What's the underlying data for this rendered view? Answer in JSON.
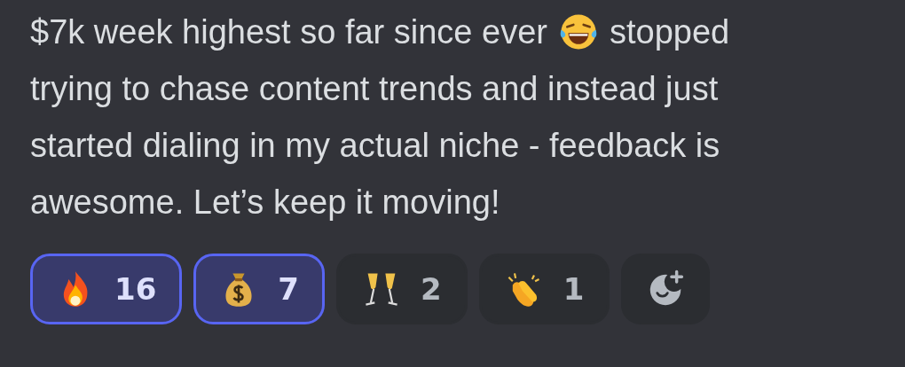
{
  "message": {
    "first_line": {
      "before": "$7k week highest so far since ever",
      "after": "stopped"
    },
    "lines": [
      "trying to chase content trends and instead just",
      "started dialing in my actual niche - feedback is",
      "awesome. Let’s keep it moving!"
    ]
  },
  "reactions": [
    {
      "count": "16",
      "selected": true
    },
    {
      "count": "7",
      "selected": true
    },
    {
      "count": "2",
      "selected": false
    },
    {
      "count": "1",
      "selected": false
    }
  ]
}
